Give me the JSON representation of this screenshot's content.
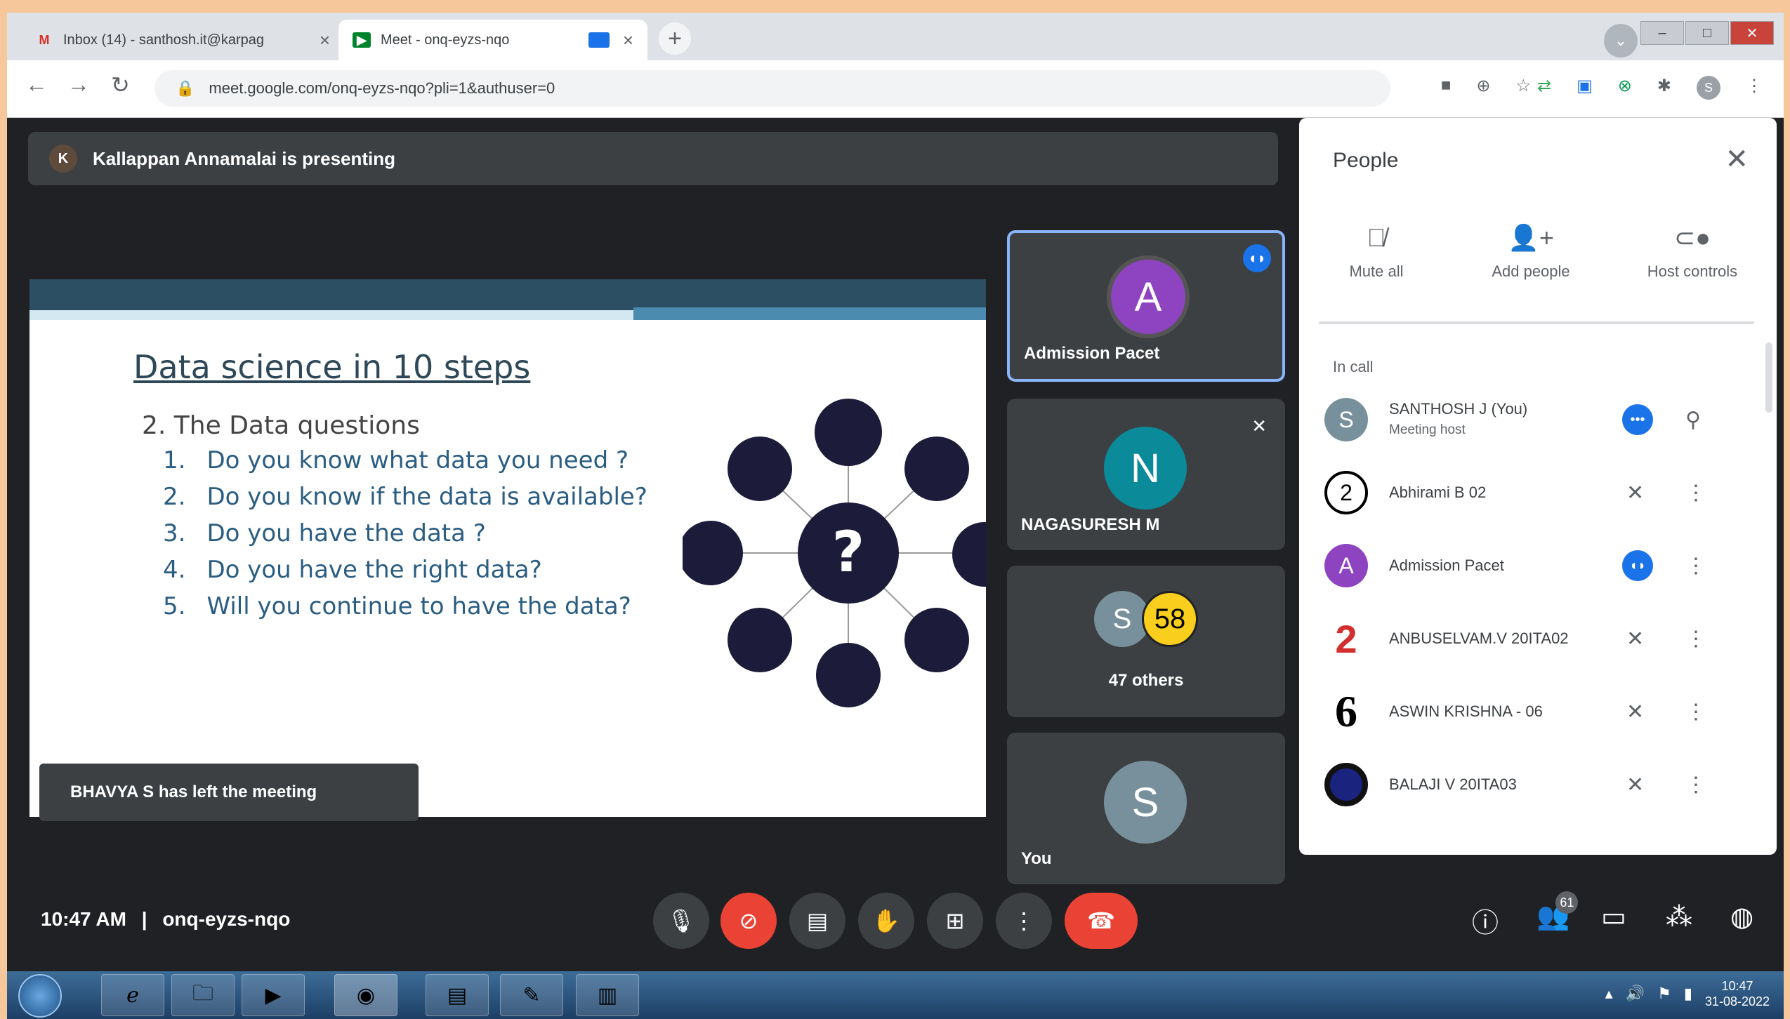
{
  "browser": {
    "tabs": [
      {
        "title": "Inbox (14) - santhosh.it@karpag",
        "icon": "gmail-icon"
      },
      {
        "title": "Meet - onq-eyzs-nqo",
        "icon": "meet-icon"
      }
    ],
    "new_tab_label": "+",
    "url": "meet.google.com/onq-eyzs-nqo?pli=1&authuser=0",
    "window_controls": {
      "minimize": "–",
      "maximize": "□",
      "close": "✕"
    },
    "profile_initial": "S"
  },
  "meet": {
    "presenting_banner": "Kallappan Annamalai is presenting",
    "presenter_initial": "K",
    "toast": "BHAVYA S has left the meeting",
    "slide": {
      "title": "Data science in 10 steps",
      "subtitle": "2. The Data questions",
      "questions": [
        {
          "num": "1.",
          "text": "Do you know what data you need ?"
        },
        {
          "num": "2.",
          "text": "Do you know if the data is available?"
        },
        {
          "num": "3.",
          "text": "Do you have the data ?"
        },
        {
          "num": "4.",
          "text": "Do you have the right data?"
        },
        {
          "num": "5.",
          "text": "Will you continue to have the data?"
        }
      ],
      "center_symbol": "?"
    },
    "tiles": [
      {
        "initial": "A",
        "name": "Admission Pacet",
        "color": "#8e44c0"
      },
      {
        "initial": "N",
        "name": "NAGASURESH M",
        "color": "#0b8a9a"
      },
      {
        "initial": "S",
        "count": "58",
        "name": "47 others",
        "color": "#78909c"
      },
      {
        "initial": "S",
        "name": "You",
        "color": "#78909c"
      }
    ],
    "people_panel": {
      "title": "People",
      "actions": [
        {
          "label": "Mute all",
          "icon": "mic-off-icon"
        },
        {
          "label": "Add people",
          "icon": "add-person-icon"
        },
        {
          "label": "Host controls",
          "icon": "toggle-icon"
        }
      ],
      "section": "In call",
      "participants": [
        {
          "avatar": "S",
          "name": "SANTHOSH J (You)",
          "sub": "Meeting host",
          "color": "#78909c"
        },
        {
          "avatar": "2",
          "name": "Abhirami B 02",
          "sub": "",
          "color": "#ffffff"
        },
        {
          "avatar": "A",
          "name": "Admission Pacet",
          "sub": "",
          "color": "#8e44c0"
        },
        {
          "avatar": "2",
          "name": "ANBUSELVAM.V 20ITA02",
          "sub": "",
          "color": "#ffffff"
        },
        {
          "avatar": "6",
          "name": "ASWIN KRISHNA - 06",
          "sub": "",
          "color": "#ffffff"
        },
        {
          "avatar": "",
          "name": "BALAJI V 20ITA03",
          "sub": "",
          "color": "#1a237e"
        }
      ]
    },
    "bottom": {
      "time": "10:47 AM",
      "separator": "|",
      "meeting_code": "onq-eyzs-nqo",
      "people_count": "61"
    }
  },
  "taskbar": {
    "time": "10:47",
    "date": "31-08-2022"
  }
}
